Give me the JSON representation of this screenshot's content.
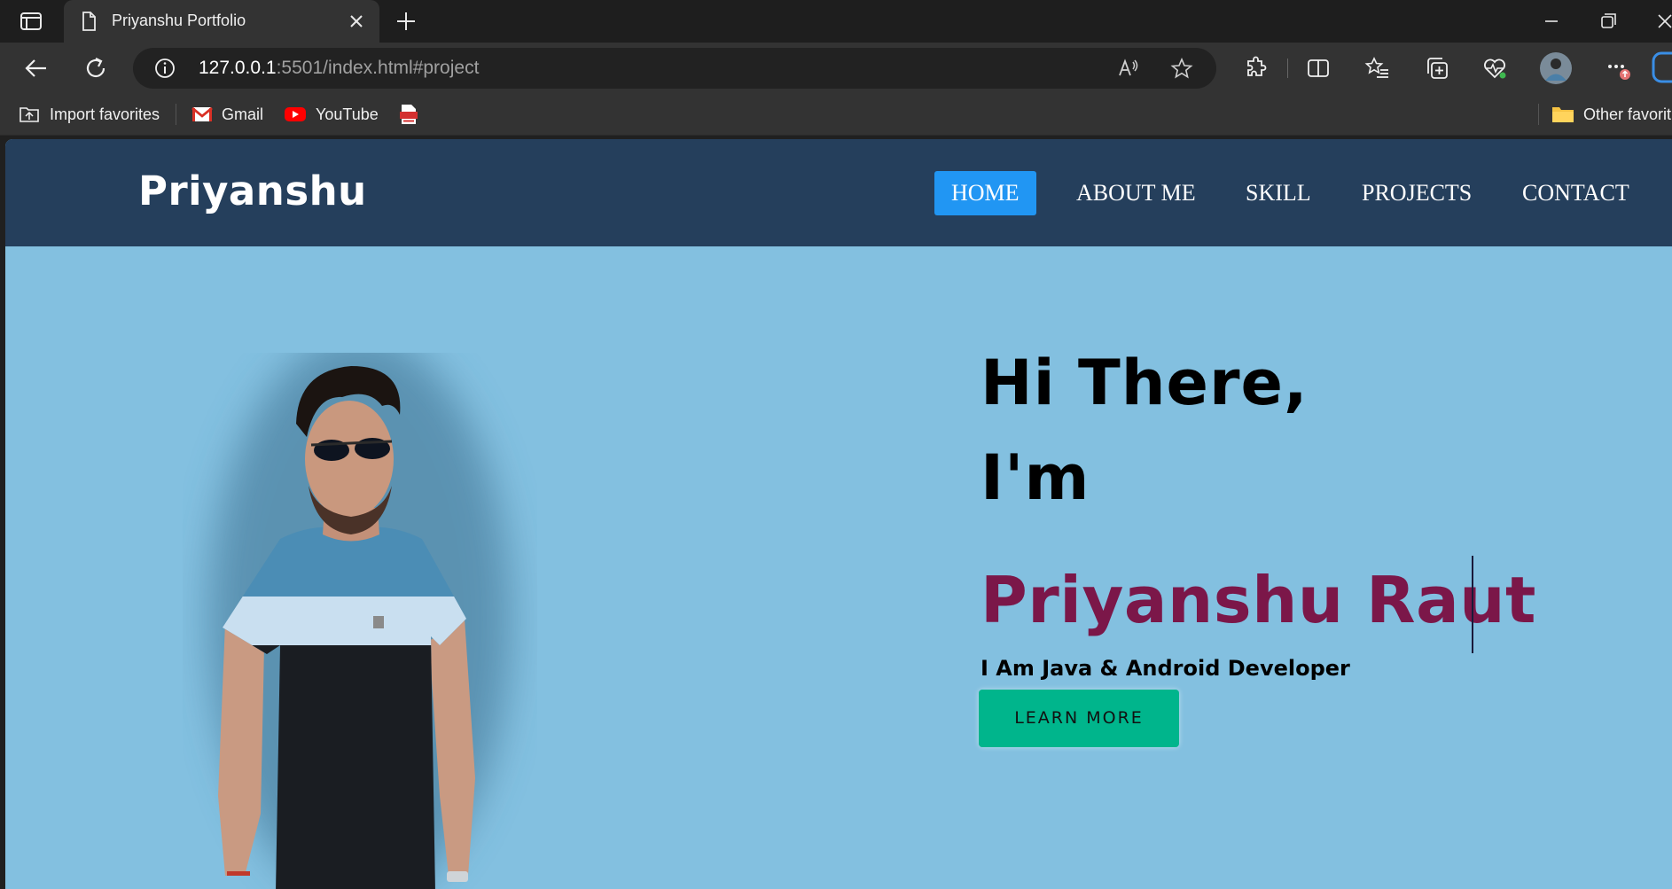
{
  "browser": {
    "tab_title": "Priyanshu Portfolio",
    "url_host": "127.0.0.1",
    "url_rest": ":5501/index.html#project",
    "favorites": [
      {
        "label": "Import favorites",
        "icon": "import-favorites-icon"
      },
      {
        "label": "Gmail",
        "icon": "gmail-icon"
      },
      {
        "label": "YouTube",
        "icon": "youtube-icon"
      },
      {
        "label": "",
        "icon": "pdf-icon"
      }
    ],
    "other_favorites": "Other favorit"
  },
  "site": {
    "logo": "Priyanshu",
    "nav": [
      {
        "label": "HOME",
        "active": true
      },
      {
        "label": "ABOUT ME",
        "active": false
      },
      {
        "label": "SKILL",
        "active": false
      },
      {
        "label": "PROJECTS",
        "active": false
      },
      {
        "label": "CONTACT",
        "active": false
      }
    ],
    "hero": {
      "line1": "Hi There,",
      "line2": "I'm",
      "name": "Priyanshu Raut",
      "subtitle": "I Am Java & Android Developer",
      "button": "LEARN MORE"
    }
  },
  "colors": {
    "nav_bg": "#253f5c",
    "nav_active": "#2196f3",
    "hero_bg": "#83c0e0",
    "name_color": "#7b1749",
    "button_bg": "#00b58c"
  }
}
